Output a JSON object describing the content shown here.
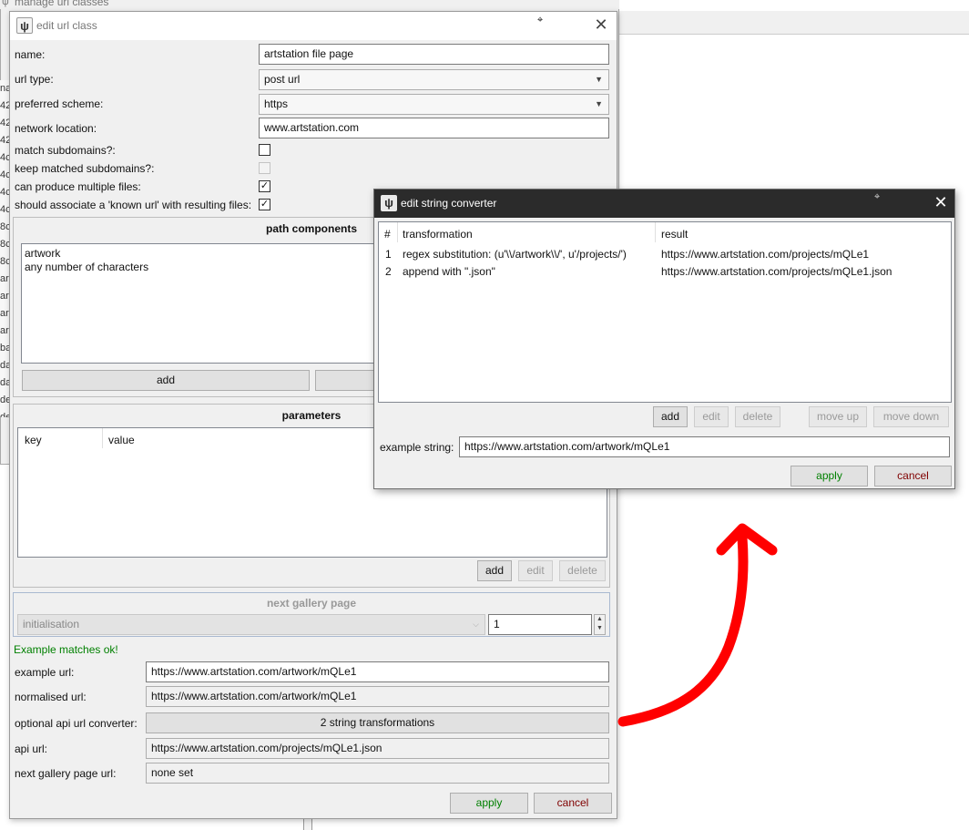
{
  "background_window": {
    "title": "manage url classes",
    "left_strip": [
      "na",
      "42",
      "42",
      "42",
      "4c",
      "4c",
      "4c",
      "4c",
      "8c",
      "8c",
      "8c",
      "ar",
      "ar",
      "ar",
      "ar",
      "ba",
      "da",
      "da",
      "de",
      "de"
    ]
  },
  "edit_url_class": {
    "title": "edit url class",
    "fields": {
      "name_label": "name:",
      "name_value": "artstation file page",
      "url_type_label": "url type:",
      "url_type_value": "post url",
      "preferred_scheme_label": "preferred scheme:",
      "preferred_scheme_value": "https",
      "network_location_label": "network location:",
      "network_location_value": "www.artstation.com",
      "match_subdomains_label": "match subdomains?:",
      "match_subdomains_checked": false,
      "keep_matched_subdomains_label": "keep matched subdomains?:",
      "keep_matched_subdomains_checked": false,
      "can_produce_multiple_label": "can produce multiple files:",
      "can_produce_multiple_checked": true,
      "associate_known_url_label": "should associate a 'known url' with resulting files:",
      "associate_known_url_checked": true
    },
    "path_components": {
      "title": "path components",
      "items": [
        "artwork",
        "any number of characters"
      ],
      "add_label": "add"
    },
    "parameters": {
      "title": "parameters",
      "columns": [
        "key",
        "value"
      ],
      "add_label": "add",
      "edit_label": "edit",
      "delete_label": "delete"
    },
    "next_gallery_page": {
      "title": "next gallery page",
      "type_value": "initialisation",
      "number_value": "1"
    },
    "status_text": "Example matches ok!",
    "example_url_label": "example url:",
    "example_url_value": "https://www.artstation.com/artwork/mQLe1",
    "normalised_url_label": "normalised url:",
    "normalised_url_value": "https://www.artstation.com/artwork/mQLe1",
    "api_converter_label": "optional api url converter:",
    "api_converter_button": "2 string transformations",
    "api_url_label": "api url:",
    "api_url_value": "https://www.artstation.com/projects/mQLe1.json",
    "next_gallery_url_label": "next gallery page url:",
    "next_gallery_url_value": "none set",
    "apply_label": "apply",
    "cancel_label": "cancel"
  },
  "edit_string_converter": {
    "title": "edit string converter",
    "columns": [
      "#",
      "transformation",
      "result"
    ],
    "rows": [
      {
        "num": "1",
        "transformation": "regex substitution: (u'\\\\/artwork\\\\/', u'/projects/')",
        "result": "https://www.artstation.com/projects/mQLe1"
      },
      {
        "num": "2",
        "transformation": "append with \".json\"",
        "result": "https://www.artstation.com/projects/mQLe1.json"
      }
    ],
    "add_label": "add",
    "edit_label": "edit",
    "delete_label": "delete",
    "move_up_label": "move up",
    "move_down_label": "move down",
    "example_string_label": "example string:",
    "example_string_value": "https://www.artstation.com/artwork/mQLe1",
    "apply_label": "apply",
    "cancel_label": "cancel"
  },
  "icons": {
    "app_icon": "psi-glyph",
    "close": "close-icon",
    "dropdown": "chevron-down-icon",
    "checkbox": "check-icon",
    "spin": "spin-arrows-icon"
  },
  "colors": {
    "apply_text": "#008000",
    "cancel_text": "#800000",
    "ok_text": "#008000",
    "dark_titlebar": "#2b2b2b",
    "arrow_annotation": "#ff0000"
  }
}
